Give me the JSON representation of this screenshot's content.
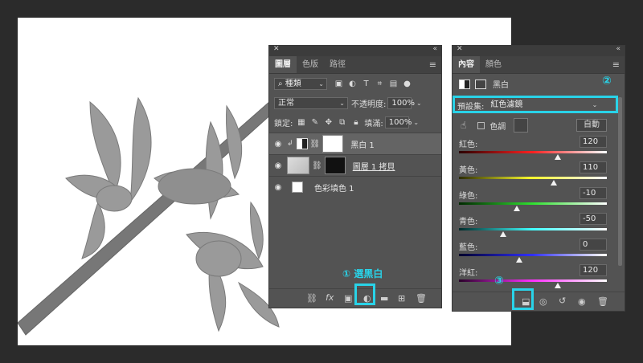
{
  "layers_panel": {
    "tabs": [
      "圖層",
      "色版",
      "路徑"
    ],
    "filter_kind": "種類",
    "blend_mode": "正常",
    "opacity_label": "不透明度:",
    "opacity_value": "100%",
    "lock_label": "鎖定:",
    "fill_label": "填滿:",
    "fill_value": "100%",
    "layers": [
      {
        "name": "黑白 1",
        "selected": true
      },
      {
        "name": "圖層 1 拷貝",
        "selected": false
      },
      {
        "name": "色彩填色 1",
        "selected": false
      }
    ],
    "footer_fx": "fx"
  },
  "properties_panel": {
    "tabs": [
      "內容",
      "顏色"
    ],
    "title": "黑白",
    "preset_label": "預設集:",
    "preset_value": "紅色濾鏡",
    "tint_label": "色調",
    "auto_label": "自動",
    "sliders": [
      {
        "label": "紅色:",
        "value": "120",
        "pos": 0.67,
        "grad": [
          "#2a0000",
          "#ff2020"
        ]
      },
      {
        "label": "黃色:",
        "value": "110",
        "pos": 0.64,
        "grad": [
          "#2a2a00",
          "#ffff30"
        ]
      },
      {
        "label": "綠色:",
        "value": "-10",
        "pos": 0.39,
        "grad": [
          "#002a00",
          "#30e030"
        ]
      },
      {
        "label": "青色:",
        "value": "-50",
        "pos": 0.3,
        "grad": [
          "#002a2a",
          "#40ffff"
        ]
      },
      {
        "label": "藍色:",
        "value": "0",
        "pos": 0.41,
        "grad": [
          "#00002a",
          "#3030ff"
        ]
      },
      {
        "label": "洋紅:",
        "value": "120",
        "pos": 0.67,
        "grad": [
          "#2a002a",
          "#ff30ff"
        ]
      }
    ]
  },
  "annotations": {
    "step1_num": "①",
    "step1_text": "選黑白",
    "step2_num": "②",
    "step3_num": "③"
  },
  "colors": {
    "highlight": "#29d3e8",
    "panel": "#535353"
  }
}
